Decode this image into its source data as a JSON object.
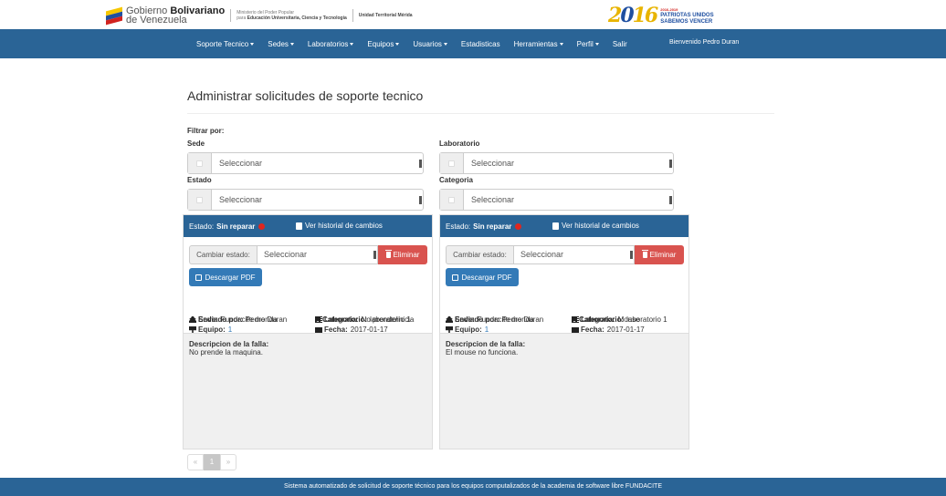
{
  "header": {
    "gobierno_line1_a": "Gobierno",
    "gobierno_line1_b": "Bolivariano",
    "gobierno_line2": "de Venezuela",
    "ministerio_line1": "Ministerio del Poder Popular",
    "ministerio_line2_a": "para",
    "ministerio_line2_b": "Educación Universitaria, Ciencia y Tecnología",
    "unidad": "Unidad Territorial Mérida",
    "campaign_2": "2",
    "campaign_0": "0",
    "campaign_16": "16",
    "campaign_years": "2016-2019",
    "campaign_line1": "PATRIOTAS UNIDOS",
    "campaign_line2": "SABEMOS VENCER"
  },
  "nav": {
    "items": [
      {
        "label": "Soporte Tecnico",
        "dropdown": true
      },
      {
        "label": "Sedes",
        "dropdown": true
      },
      {
        "label": "Laboratorios",
        "dropdown": true
      },
      {
        "label": "Equipos",
        "dropdown": true
      },
      {
        "label": "Usuarios",
        "dropdown": true
      },
      {
        "label": "Estadisticas",
        "dropdown": false
      },
      {
        "label": "Herramientas",
        "dropdown": true
      },
      {
        "label": "Perfil",
        "dropdown": true
      },
      {
        "label": "Salir",
        "dropdown": false
      }
    ],
    "welcome": "Bienvenido Pedro Duran"
  },
  "page_title": "Administrar solicitudes de soporte tecnico",
  "filters": {
    "heading": "Filtrar por:",
    "sede_label": "Sede",
    "sede_value": "Seleccionar",
    "laboratorio_label": "Laboratorio",
    "laboratorio_value": "Seleccionar",
    "estado_label": "Estado",
    "estado_value": "Seleccionar",
    "categoria_label": "Categoria",
    "categoria_value": "Seleccionar"
  },
  "card_common": {
    "estado_prefix": "Estado:",
    "historial": "Ver historial de cambios",
    "cambiar_estado": "Cambiar estado:",
    "select_value": "Seleccionar",
    "eliminar": "Eliminar",
    "descargar": "Descargar PDF",
    "sede_lbl": "Sede:",
    "lab_lbl": "Laboratorio:",
    "equipo_lbl": "Equipo:",
    "fecha_lbl": "Fecha:",
    "enviado_lbl": "Enviado por:",
    "categoria_lbl": "Categoria:",
    "desc_title": "Descripcion de la falla:"
  },
  "cards": [
    {
      "estado": "Sin reparar",
      "status_color": "#e0261f",
      "sede": "Fundacite merida",
      "laboratorio": "laboratorio 1",
      "equipo": "1",
      "fecha": "2017-01-17",
      "enviado": "Pedro Duran",
      "categoria": "No prende/inicia",
      "descripcion": "No prende la maquina."
    },
    {
      "estado": "Sin reparar",
      "status_color": "#e0261f",
      "sede": "Fundacite merida",
      "laboratorio": "laboratorio 1",
      "equipo": "1",
      "fecha": "2017-01-17",
      "enviado": "Pedro Duran",
      "categoria": "Mouse",
      "descripcion": "El mouse no funciona."
    }
  ],
  "pagination": {
    "prev": "«",
    "current": "1",
    "next": "»"
  },
  "footer": "Sistema automatizado de solicitud de soporte técnico para los equipos computalizados de la academia de software libre FUNDACITE",
  "colors": {
    "primary": "#2a6496",
    "danger": "#d9534f",
    "button": "#337ab7"
  }
}
